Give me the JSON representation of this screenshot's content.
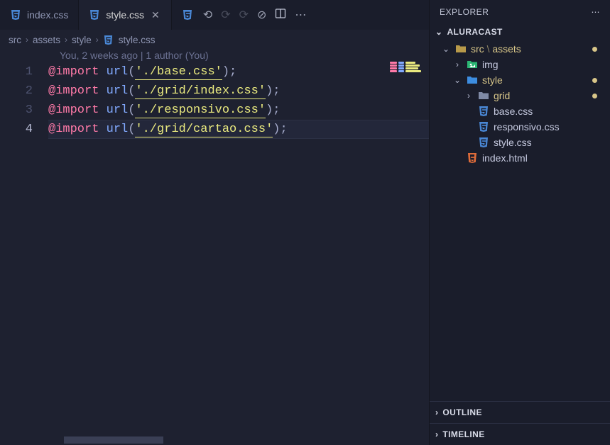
{
  "tabs": [
    {
      "label": "index.css",
      "active": false,
      "closable": false
    },
    {
      "label": "style.css",
      "active": true,
      "closable": true
    }
  ],
  "explorer_title": "EXPLORER",
  "breadcrumb": {
    "parts": [
      "src",
      "assets",
      "style"
    ],
    "file": "style.css"
  },
  "blame": "You, 2 weeks ago | 1 author (You)",
  "code": {
    "lines": [
      {
        "n": "1",
        "keyword": "@import",
        "fn": "url",
        "open": "(",
        "str": "'./base.css'",
        "close": ");",
        "current": false
      },
      {
        "n": "2",
        "keyword": "@import",
        "fn": "url",
        "open": "(",
        "str": "'./grid/index.css'",
        "close": ");",
        "current": false
      },
      {
        "n": "3",
        "keyword": "@import",
        "fn": "url",
        "open": "(",
        "str": "'./responsivo.css'",
        "close": ");",
        "current": false
      },
      {
        "n": "4",
        "keyword": "@import",
        "fn": "url",
        "open": "(",
        "str": "'./grid/cartao.css'",
        "close": ");",
        "current": true
      }
    ]
  },
  "explorer": {
    "root": "ALURACAST",
    "tree": [
      {
        "type": "folder",
        "name": "src \\ assets",
        "depth": 0,
        "open": true,
        "mod": true,
        "icon": "folder-open",
        "color": "#b89a4a"
      },
      {
        "type": "folder",
        "name": "img",
        "depth": 1,
        "open": false,
        "mod": false,
        "icon": "folder-img",
        "color": "#2bb673"
      },
      {
        "type": "folder",
        "name": "style",
        "depth": 1,
        "open": true,
        "mod": true,
        "icon": "folder-open",
        "color": "#3d8de0"
      },
      {
        "type": "folder",
        "name": "grid",
        "depth": 2,
        "open": false,
        "mod": true,
        "icon": "folder",
        "color": "#7f8aa6"
      },
      {
        "type": "file",
        "name": "base.css",
        "depth": 2,
        "mod": false,
        "icon": "css",
        "color": "#4a88d6"
      },
      {
        "type": "file",
        "name": "responsivo.css",
        "depth": 2,
        "mod": false,
        "icon": "css",
        "color": "#4a88d6"
      },
      {
        "type": "file",
        "name": "style.css",
        "depth": 2,
        "mod": false,
        "icon": "css",
        "color": "#4a88d6"
      },
      {
        "type": "file",
        "name": "index.html",
        "depth": 1,
        "mod": false,
        "icon": "html",
        "color": "#e06c3a"
      }
    ],
    "outline": "OUTLINE",
    "timeline": "TIMELINE"
  }
}
